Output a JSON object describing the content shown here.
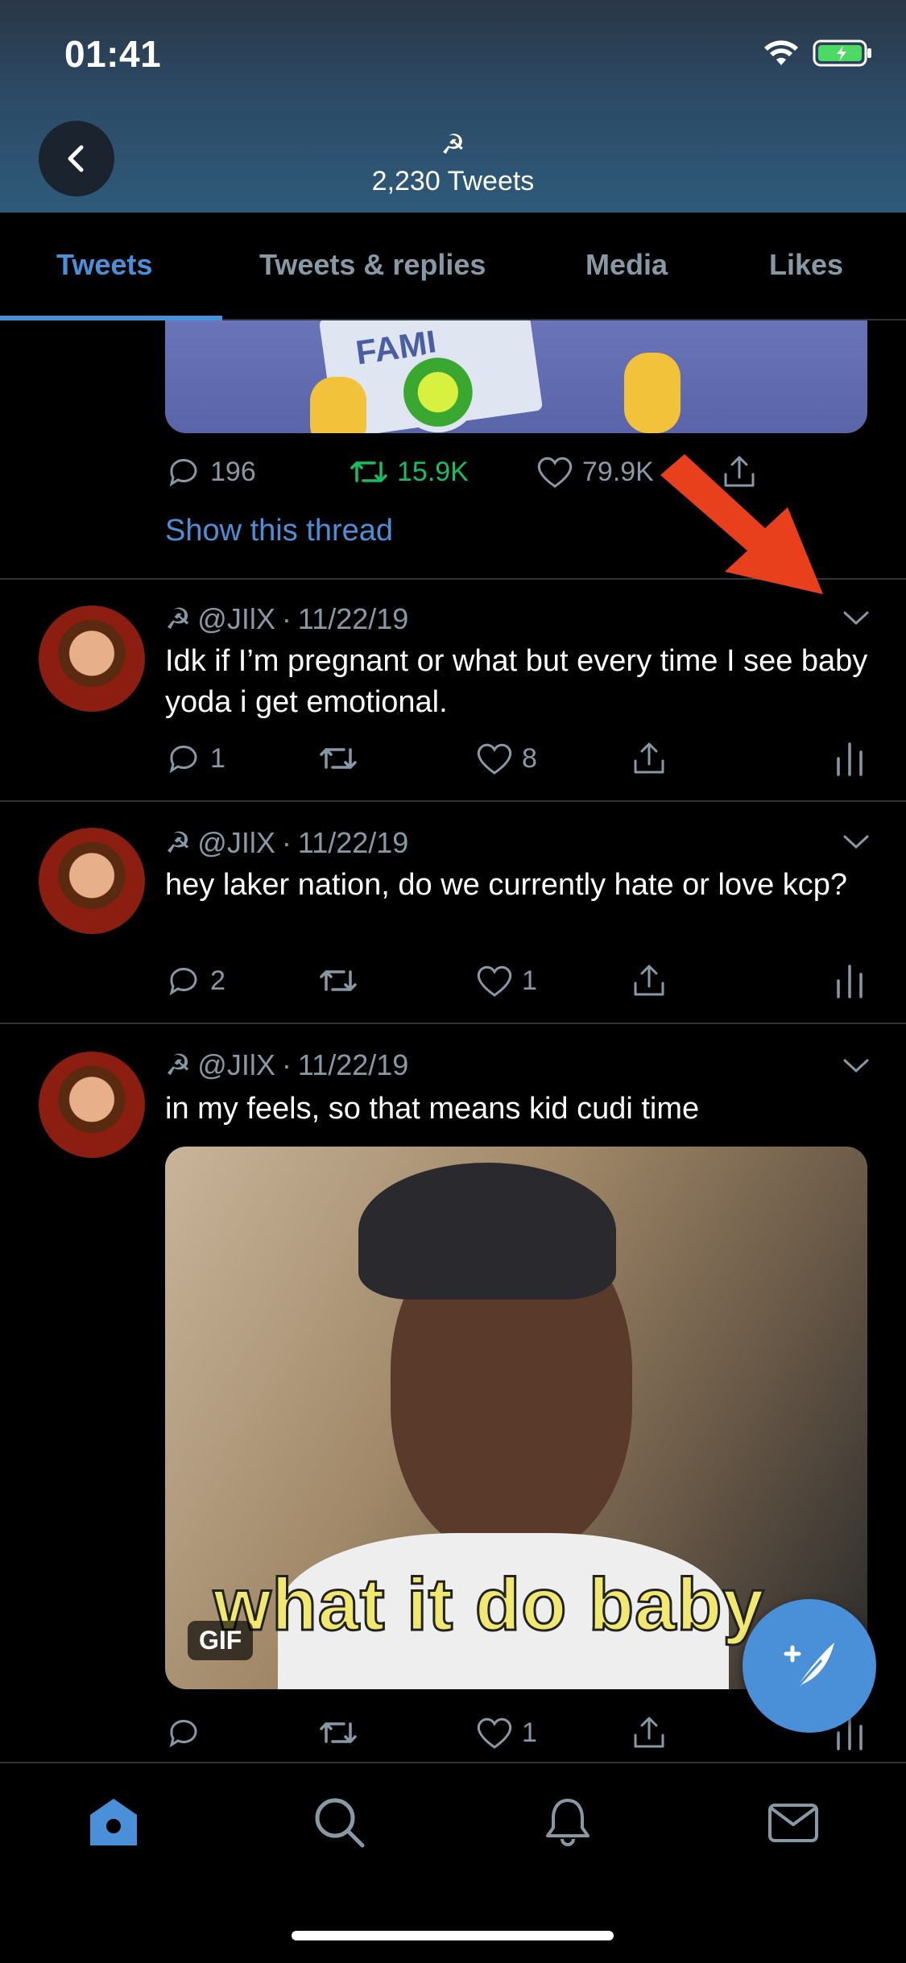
{
  "status_bar": {
    "time": "01:41"
  },
  "header": {
    "title_symbol": "☭",
    "subtitle": "2,230 Tweets"
  },
  "tabs": [
    {
      "label": "Tweets",
      "active": true
    },
    {
      "label": "Tweets & replies",
      "active": false
    },
    {
      "label": "Media",
      "active": false
    },
    {
      "label": "Likes",
      "active": false
    }
  ],
  "thread_tail": {
    "replies": "196",
    "retweets": "15.9K",
    "likes": "79.9K",
    "show_thread": "Show this thread",
    "media_text": "FAMI"
  },
  "tweets": [
    {
      "name_symbol": "☭",
      "handle": "@JIlX",
      "dot": "·",
      "date": "11/22/19",
      "text": "Idk if I’m pregnant or what but every time I see baby yoda i get emotional.",
      "replies": "1",
      "retweets": "",
      "likes": "8"
    },
    {
      "name_symbol": "☭",
      "handle": "@JIlX",
      "dot": "·",
      "date": "11/22/19",
      "text": "hey laker nation, do we currently hate or love kcp?",
      "replies": "2",
      "retweets": "",
      "likes": "1"
    },
    {
      "name_symbol": "☭",
      "handle": "@JIlX",
      "dot": "·",
      "date": "11/22/19",
      "text": "in my feels, so that means kid cudi time",
      "gif_caption": "what it do baby",
      "gif_badge": "GIF",
      "replies": "",
      "retweets": "",
      "likes": "1"
    }
  ],
  "colors": {
    "accent": "#4a90d9",
    "retweet_green": "#17bf63",
    "muted": "#8899a6",
    "annotation_arrow": "#e8401c"
  }
}
